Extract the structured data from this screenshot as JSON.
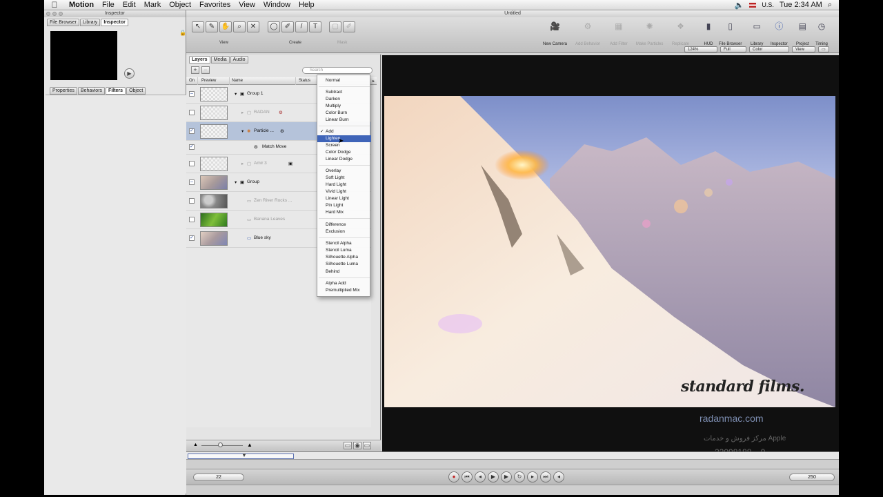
{
  "menubar": {
    "app": "Motion",
    "items": [
      "File",
      "Edit",
      "Mark",
      "Object",
      "Favorites",
      "View",
      "Window",
      "Help"
    ],
    "input_source": "U.S.",
    "clock": "Tue 2:34 AM"
  },
  "inspector": {
    "title": "Inspector",
    "top_tabs": [
      "File Browser",
      "Library",
      "Inspector"
    ],
    "sub_tabs": [
      "Properties",
      "Behaviors",
      "Filters",
      "Object"
    ]
  },
  "main_window": {
    "title": "Untitled",
    "toolbar": {
      "group_labels": [
        "View",
        "Create",
        "Mask"
      ],
      "right_buttons": [
        {
          "label": "New Camera",
          "icon": "camera-icon"
        },
        {
          "label": "Add Behavior",
          "icon": "gear-icon"
        },
        {
          "label": "Add Filter",
          "icon": "filter-icon"
        },
        {
          "label": "Make Particles",
          "icon": "particles-icon"
        },
        {
          "label": "Replicate",
          "icon": "replicate-icon"
        },
        {
          "label": "HUD",
          "icon": "hud-icon"
        },
        {
          "label": "File Browser",
          "icon": "file-browser-icon"
        },
        {
          "label": "Library",
          "icon": "library-icon"
        },
        {
          "label": "Inspector",
          "icon": "info-icon"
        },
        {
          "label": "Project",
          "icon": "project-icon"
        },
        {
          "label": "Timing",
          "icon": "timing-icon"
        }
      ]
    },
    "canvas_controls": {
      "zoom": "124%",
      "resolution": "Full",
      "channels": "Color",
      "view": "View"
    }
  },
  "layers_panel": {
    "tabs": [
      "Layers",
      "Media",
      "Audio"
    ],
    "search_placeholder": "Search",
    "columns": [
      "On",
      "Preview",
      "Name",
      "Status"
    ],
    "rows": [
      {
        "name": "Group 1",
        "checked": "–"
      },
      {
        "name": "RADAN",
        "checked": ""
      },
      {
        "name": "Particle ...",
        "checked": "✓"
      },
      {
        "name": "Match Move",
        "checked": "✓"
      },
      {
        "name": "Amir 3",
        "checked": ""
      },
      {
        "name": "Group",
        "checked": "–"
      },
      {
        "name": "Zen River Rocks ...",
        "checked": ""
      },
      {
        "name": "Banana Leaves",
        "checked": ""
      },
      {
        "name": "Blue sky",
        "checked": "✓"
      }
    ]
  },
  "blend_menu": {
    "items": [
      "Normal",
      "Subtract",
      "Darken",
      "Multiply",
      "Color Burn",
      "Linear Burn",
      "Add",
      "Lighten",
      "Screen",
      "Color Dodge",
      "Linear Dodge",
      "Overlay",
      "Soft Light",
      "Hard Light",
      "Vivid Light",
      "Linear Light",
      "Pin Light",
      "Hard Mix",
      "Difference",
      "Exclusion",
      "Stencil Alpha",
      "Stencil Luma",
      "Silhouette Alpha",
      "Silhouette Luma",
      "Behind",
      "Alpha Add",
      "Premultiplied Mix"
    ],
    "checked_item": "Add",
    "checkmark": "✓",
    "highlighted_item": "Lighten"
  },
  "watermark": {
    "brand": "standard films.",
    "site": "radanmac.com",
    "persian": "مرکز فروش و خدمات Apple",
    "phone": "22098188 – 9"
  },
  "timeline": {
    "current_frame": "22",
    "end_frame": "250"
  },
  "colors": {
    "selection": "#b5c3da",
    "menu_highlight": "#3f64b8"
  }
}
